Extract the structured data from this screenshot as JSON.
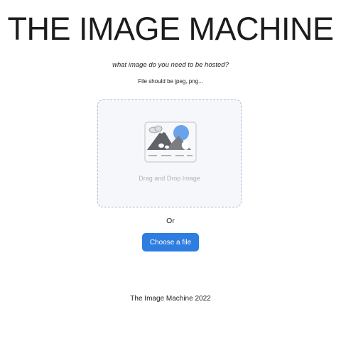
{
  "header": {
    "title": "THE IMAGE MACHINE",
    "prompt": "what image do you need to be hosted?",
    "file_hint": "File should be jpeg, png..."
  },
  "upload": {
    "drop_label": "Drag and Drop Image",
    "illustration_icon": "image-placeholder-icon",
    "or_label": "Or",
    "choose_button_label": "Choose a file"
  },
  "footer": {
    "text": "The Image Machine 2022"
  },
  "colors": {
    "accent": "#2e7de1",
    "dropzone_bg": "#f5f7fb",
    "dropzone_border": "#a9bcd6"
  }
}
